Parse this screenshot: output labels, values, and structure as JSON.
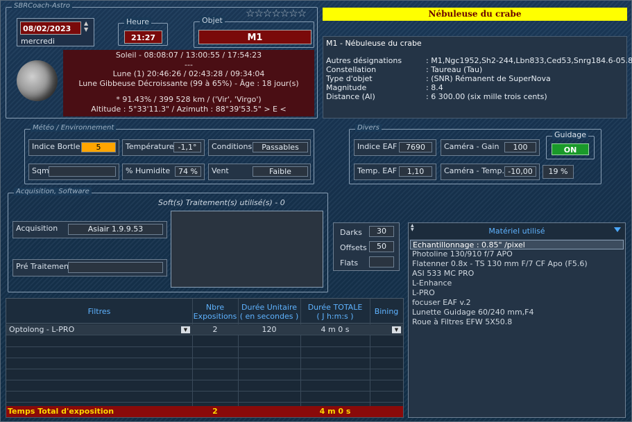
{
  "app": {
    "title": "SBRCoach-Astro"
  },
  "date": {
    "value": "08/02/2023",
    "weekday": "mercredi"
  },
  "heure": {
    "label": "Heure",
    "value": "21:27"
  },
  "objet": {
    "label": "Objet",
    "value": "M1"
  },
  "ephemeris": {
    "line1": "Soleil - 08:08:07 / 13:00:55 / 17:54:23",
    "line2": "---",
    "line3": "Lune (1) 20:46:26 / 02:43:28 / 09:34:04",
    "line4": "Lune Gibbeuse Décroissante (99 à 65%) - Âge : 18 jour(s)",
    "line5": "* 91.43%  / 399 528 km / ('Vir', 'Virgo')",
    "line6": "Altitude : 5°33'11.3\" / Azimuth : 88°39'53.5\" > E <"
  },
  "object_info": {
    "banner": "Nébuleuse du crabe",
    "heading": "M1 - Nébuleuse du crabe",
    "rows": [
      {
        "k": "Autres désignations",
        "v": ": M1,Ngc1952,Sh2-244,Lbn833,Ced53,Snrg184.6-05.8"
      },
      {
        "k": "Constellation",
        "v": ": Taureau (Tau)"
      },
      {
        "k": "Type d'objet",
        "v": ": (SNR) Rémanent de SuperNova"
      },
      {
        "k": "Magnitude",
        "v": ": 8.4"
      },
      {
        "k": "Distance (Al)",
        "v": ": 6 300.00 (six mille trois cents)"
      }
    ]
  },
  "meteo": {
    "title": "Météo / Environnement",
    "bortle_label": "Indice Bortle",
    "bortle": "5",
    "temp_label": "Température",
    "temp": "-1,1°",
    "cond_label": "Conditions",
    "cond": "Passables",
    "sqm_label": "Sqm",
    "sqm": "",
    "hum_label": "% Humidite",
    "hum": "74 %",
    "vent_label": "Vent",
    "vent": "Faible"
  },
  "divers": {
    "title": "Divers",
    "eaf_label": "Indice EAF",
    "eaf": "7690",
    "gain_label": "Caméra - Gain",
    "gain": "100",
    "teaf_label": "Temp. EAF",
    "teaf": "1,10",
    "ctemp_label": "Caméra - Temp.",
    "ctemp": "-10,00",
    "ctemp_pct": "19 %",
    "guidage_label": "Guidage",
    "guidage": "ON"
  },
  "acq": {
    "title": "Acquisition, Software",
    "soft_title": "Soft(s) Traitement(s) utilisé(s) - 0",
    "acq_label": "Acquisition",
    "acq_value": "Asiair 1.9.9.53",
    "pre_label": "Pré Traitement",
    "pre_value": ""
  },
  "calib": {
    "darks_label": "Darks",
    "darks": "30",
    "offsets_label": "Offsets",
    "offsets": "50",
    "flats_label": "Flats",
    "flats": ""
  },
  "filters": {
    "col_filtres": "Filtres",
    "col_nbre1": "Nbre",
    "col_nbre2": "Expositions",
    "col_duree1": "Durée Unitaire",
    "col_duree2": "( en secondes )",
    "col_total1": "Durée TOTALE",
    "col_total2": "( J h:m:s )",
    "col_bining": "Bining",
    "row": {
      "filtre": "Optolong - L-PRO",
      "nbre": "2",
      "duree": "120",
      "total": "4 m 0 s",
      "bining": ""
    },
    "footer": {
      "label": "Temps Total d'exposition",
      "nbre": "2",
      "total": "4 m 0 s"
    }
  },
  "materiel": {
    "title": "Matériel utilisé",
    "items": [
      "Echantillonnage : 0.85\" /pixel",
      "Photoline 130/910 f/7 APO",
      "Flatenner 0.8x - TS 130 mm F/7 CF Apo (F5.6)",
      "ASI 533 MC PRO",
      "L-Enhance",
      "L-PRO",
      "focuser EAF v.2",
      "Lunette Guidage 60/240 mm,F4",
      "Roue à Filtres EFW 5X50.8"
    ]
  },
  "colors": {
    "banner": "#ffff00",
    "accent_red": "#7a0a0a",
    "guidage_on": "#1a9a2a",
    "bortle": "#ffa500",
    "header_blue": "#5fb3ff"
  }
}
